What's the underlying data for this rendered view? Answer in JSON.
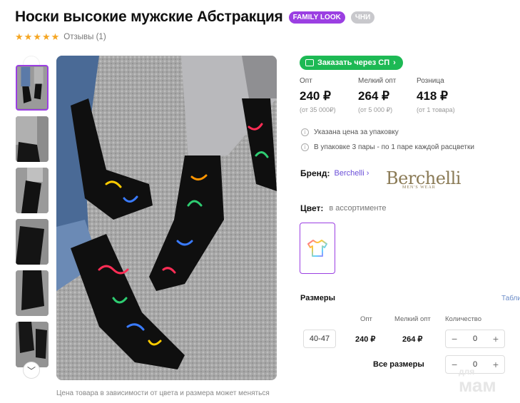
{
  "product": {
    "title": "Носки высокие мужские Абстракция",
    "badges": [
      "FAMILY LOOK",
      "ЧНИ"
    ],
    "rating": 5,
    "reviews_label": "Отзывы (1)"
  },
  "gallery": {
    "thumbnail_count": 6,
    "active_index": 0,
    "price_note": "Цена товара в зависимости от цвета и размера может меняться"
  },
  "order_button": "Заказать через СП",
  "prices": [
    {
      "label": "Опт",
      "value": "240 ₽",
      "sub": "(от 35 000₽)"
    },
    {
      "label": "Мелкий опт",
      "value": "264 ₽",
      "sub": "(от 5 000 ₽)"
    },
    {
      "label": "Розница",
      "value": "418 ₽",
      "sub": "(от 1 товара)"
    }
  ],
  "info": {
    "line1": "Указана цена за упаковку",
    "line2": "В упаковке 3 пары - по 1 паре каждой расцветки"
  },
  "brand": {
    "label": "Бренд:",
    "name": "Berchelli",
    "logo_text": "Berchelli",
    "logo_sub": "MEN'S WEAR"
  },
  "color": {
    "label": "Цвет:",
    "value": "в ассортименте"
  },
  "sizes": {
    "title": "Размеры",
    "table_link": "Табли",
    "headers": {
      "opt": "Опт",
      "small_opt": "Мелкий опт",
      "quantity": "Количество"
    },
    "rows": [
      {
        "size": "40-47",
        "opt": "240 ₽",
        "small_opt": "264 ₽",
        "quantity": "0"
      }
    ],
    "all_sizes_label": "Все размеры",
    "all_sizes_quantity": "0"
  },
  "watermark": {
    "top": "для",
    "bottom": "мам"
  },
  "colors": {
    "accent": "#9b3fe2",
    "green": "#1db954",
    "link": "#6b4fd8"
  }
}
